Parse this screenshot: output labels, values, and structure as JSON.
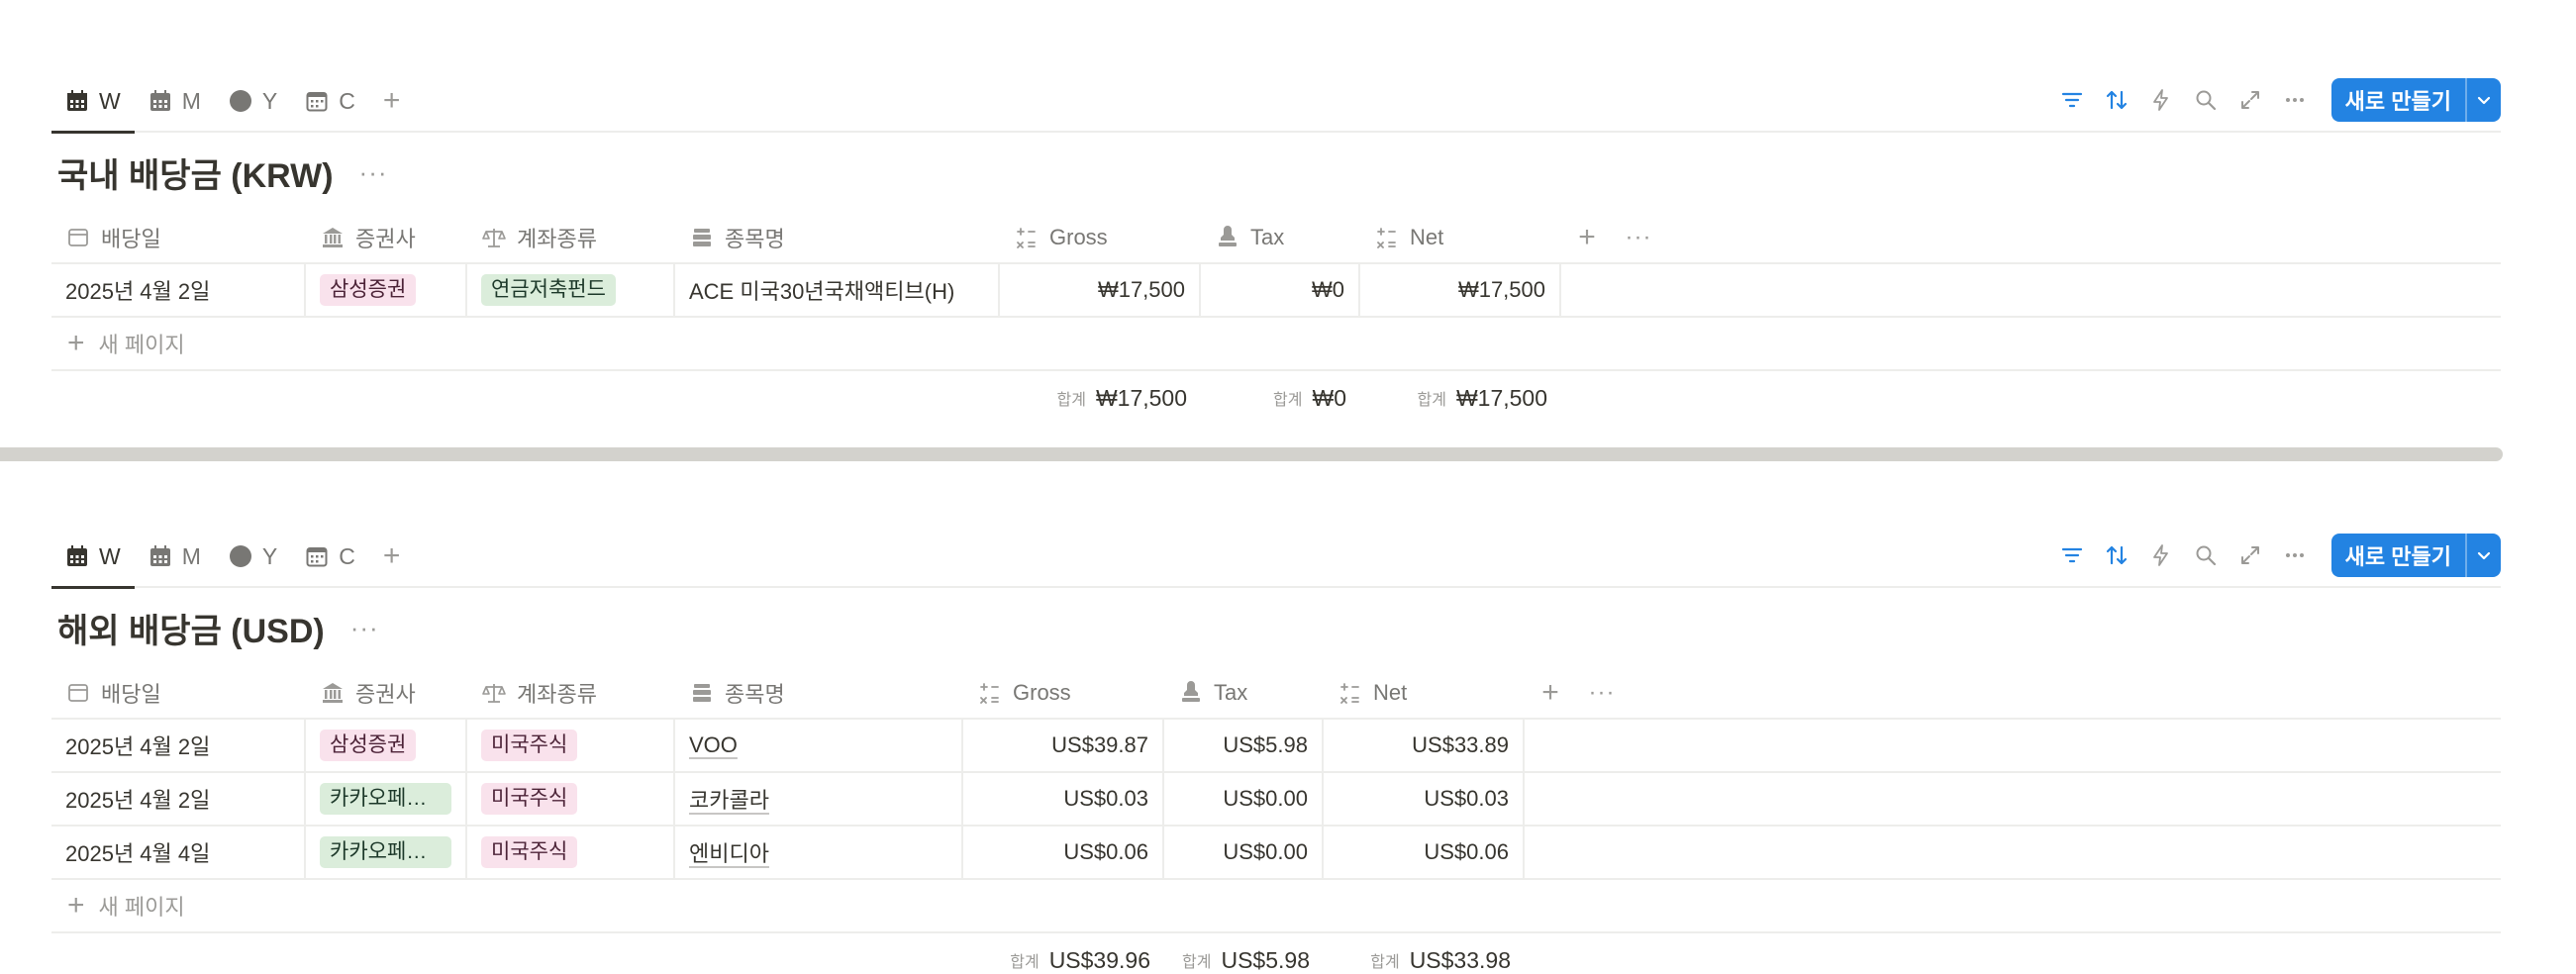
{
  "colors": {
    "accent": "#2383e2",
    "pink_tag": "#f9e2ec",
    "green_tag": "#dbeddb",
    "divider": "#d3d2cd"
  },
  "views": [
    {
      "label": "W",
      "icon": "calendar-grid-icon",
      "active": true
    },
    {
      "label": "M",
      "icon": "calendar-grid-icon",
      "active": false
    },
    {
      "label": "Y",
      "icon": "circle-icon",
      "active": false
    },
    {
      "label": "C",
      "icon": "calendar-icon",
      "active": false
    }
  ],
  "add_view": "+",
  "toolbar": {
    "new_button": "새로 만들기"
  },
  "columns": {
    "date": "배당일",
    "broker": "증권사",
    "account": "계좌종류",
    "name": "종목명",
    "gross": "Gross",
    "tax": "Tax",
    "net": "Net"
  },
  "new_page": "새 페이지",
  "sum_label": "합계",
  "krw": {
    "title": "국내 배당금 (KRW)",
    "rows": [
      {
        "date": "2025년 4월 2일",
        "broker": "삼성증권",
        "account": "연금저축펀드",
        "name": "ACE 미국30년국채액티브(H)",
        "gross": "₩17,500",
        "tax": "₩0",
        "net": "₩17,500"
      }
    ],
    "sums": {
      "gross": "₩17,500",
      "tax": "₩0",
      "net": "₩17,500"
    }
  },
  "usd": {
    "title": "해외 배당금 (USD)",
    "rows": [
      {
        "date": "2025년 4월 2일",
        "broker": "삼성증권",
        "account": "미국주식",
        "name": "VOO",
        "gross": "US$39.87",
        "tax": "US$5.98",
        "net": "US$33.89"
      },
      {
        "date": "2025년 4월 2일",
        "broker": "카카오페이...",
        "account": "미국주식",
        "name": "코카콜라",
        "gross": "US$0.03",
        "tax": "US$0.00",
        "net": "US$0.03"
      },
      {
        "date": "2025년 4월 4일",
        "broker": "카카오페이...",
        "account": "미국주식",
        "name": "엔비디아",
        "gross": "US$0.06",
        "tax": "US$0.00",
        "net": "US$0.06"
      }
    ],
    "sums": {
      "gross": "US$39.96",
      "tax": "US$5.98",
      "net": "US$33.98"
    }
  }
}
